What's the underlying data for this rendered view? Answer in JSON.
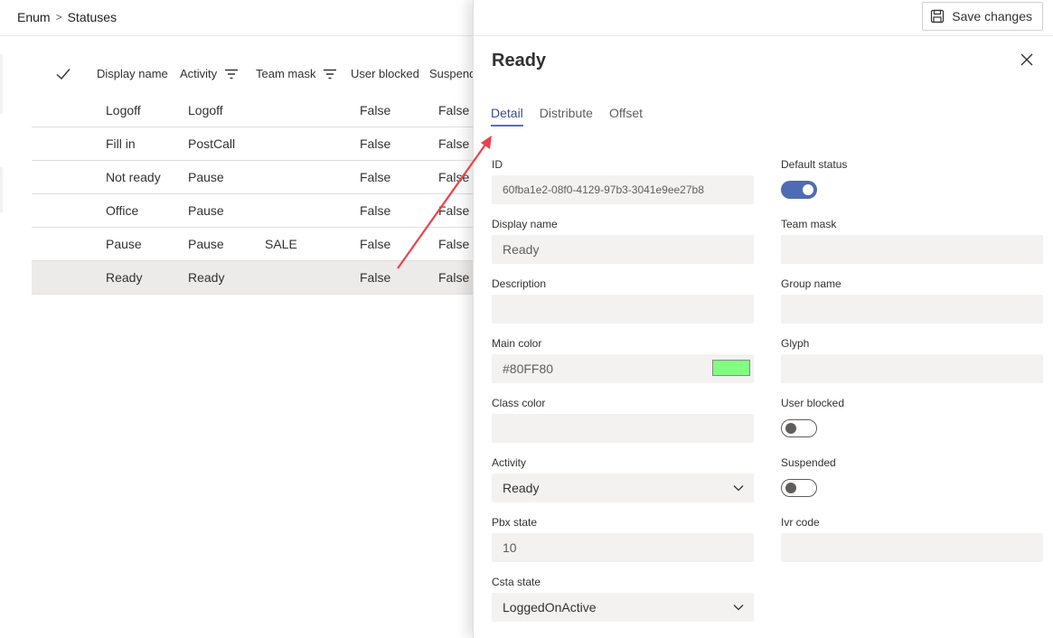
{
  "breadcrumb": {
    "root": "Enum",
    "separator": ">",
    "current": "Statuses"
  },
  "grid": {
    "columns": {
      "display_name": "Display name",
      "activity": "Activity",
      "team_mask": "Team mask",
      "user_blocked": "User blocked",
      "suspended": "Suspende"
    },
    "rows": [
      {
        "display_name": "Logoff",
        "activity": "Logoff",
        "team_mask": "",
        "user_blocked": "False",
        "suspended": "False"
      },
      {
        "display_name": "Fill in",
        "activity": "PostCall",
        "team_mask": "",
        "user_blocked": "False",
        "suspended": "False"
      },
      {
        "display_name": "Not ready",
        "activity": "Pause",
        "team_mask": "",
        "user_blocked": "False",
        "suspended": "False"
      },
      {
        "display_name": "Office",
        "activity": "Pause",
        "team_mask": "",
        "user_blocked": "False",
        "suspended": "False"
      },
      {
        "display_name": "Pause",
        "activity": "Pause",
        "team_mask": "SALE",
        "user_blocked": "False",
        "suspended": "False"
      },
      {
        "display_name": "Ready",
        "activity": "Ready",
        "team_mask": "",
        "user_blocked": "False",
        "suspended": "False"
      }
    ],
    "selected_row": "Ready"
  },
  "panel": {
    "save_label": "Save changes",
    "title": "Ready",
    "tabs": [
      {
        "label": "Detail",
        "active": true
      },
      {
        "label": "Distribute",
        "active": false
      },
      {
        "label": "Offset",
        "active": false
      }
    ],
    "fields": {
      "id": {
        "label": "ID",
        "value": "60fba1e2-08f0-4129-97b3-3041e9ee27b8"
      },
      "display_name": {
        "label": "Display name",
        "value": "Ready"
      },
      "description": {
        "label": "Description",
        "value": ""
      },
      "main_color": {
        "label": "Main color",
        "value": "#80FF80"
      },
      "class_color": {
        "label": "Class color",
        "value": ""
      },
      "activity": {
        "label": "Activity",
        "value": "Ready"
      },
      "pbx_state": {
        "label": "Pbx state",
        "value": "10"
      },
      "csta_state": {
        "label": "Csta state",
        "value": "LoggedOnActive"
      },
      "default_status": {
        "label": "Default status",
        "on": true
      },
      "team_mask": {
        "label": "Team mask",
        "value": ""
      },
      "group_name": {
        "label": "Group name",
        "value": ""
      },
      "glyph": {
        "label": "Glyph",
        "value": ""
      },
      "user_blocked": {
        "label": "User blocked",
        "on": false
      },
      "suspended": {
        "label": "Suspended",
        "on": false
      },
      "ivr_code": {
        "label": "Ivr code",
        "value": ""
      }
    }
  },
  "colors": {
    "accent": "#4f6bed",
    "toggle_on": "#4f6bb3",
    "swatch": "#80FF80",
    "arrow": "#e8434b"
  },
  "icons": {
    "save": "save-icon",
    "close": "close-icon",
    "check": "checkmark-icon",
    "filter": "filter-icon",
    "chevron": "chevron-down-icon"
  }
}
